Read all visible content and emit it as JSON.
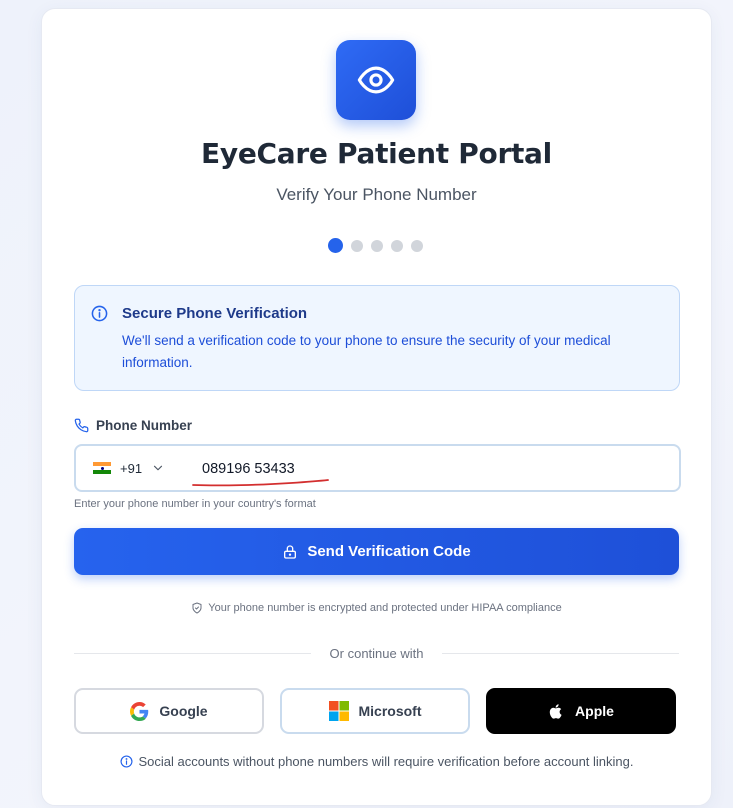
{
  "header": {
    "logo_icon": "eye-icon",
    "title": "EyeCare Patient Portal",
    "subtitle": "Verify Your Phone Number"
  },
  "progress": {
    "current_step": 1,
    "total_steps": 5
  },
  "info_box": {
    "icon": "info-icon",
    "title": "Secure Phone Verification",
    "text": "We'll send a verification code to your phone to ensure the security of your medical information."
  },
  "phone": {
    "label": "Phone Number",
    "label_icon": "phone-icon",
    "country_code": "+91",
    "country_flag": "india-flag-icon",
    "value": "089196 53433",
    "hint": "Enter your phone number in your country's format"
  },
  "send_button": {
    "label": "Send Verification Code",
    "icon": "lock-icon"
  },
  "security_note": "Your phone number is encrypted and protected under HIPAA compliance",
  "divider_text": "Or continue with",
  "social": {
    "google": "Google",
    "microsoft": "Microsoft",
    "apple": "Apple"
  },
  "footer_note": "Social accounts without phone numbers will require verification before account linking.",
  "colors": {
    "primary": "#2563eb",
    "info_bg": "#eff6ff",
    "info_title": "#1e3a8a",
    "apple_bg": "#000000",
    "annotation_red": "#d32f2f"
  }
}
